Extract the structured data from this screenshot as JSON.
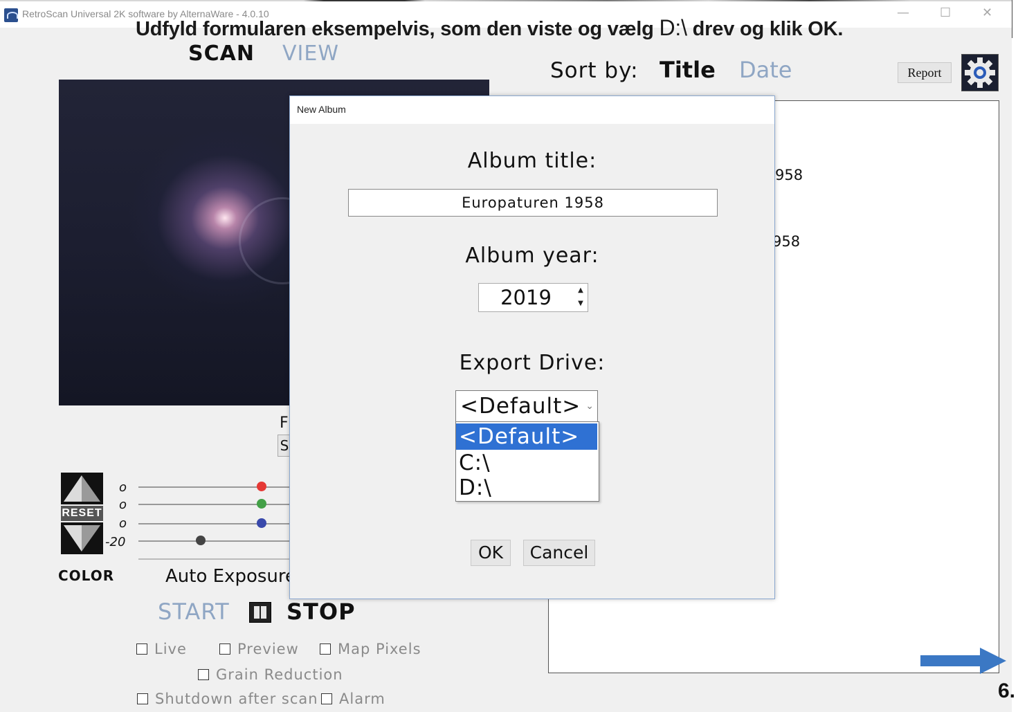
{
  "window": {
    "title": "RetroScan Universal 2K software by AlternaWare - 4.0.10",
    "minimize": "—",
    "maximize": "☐",
    "close": "✕"
  },
  "instruction": {
    "before": "Udfyld formularen eksempelvis, som den viste og vælg ",
    "drive": "D:\\",
    "after": " drev og klik OK."
  },
  "tabs": {
    "scan": "SCAN",
    "view": "VIEW"
  },
  "sort": {
    "label": "Sort by:",
    "title": "Title",
    "date": "Date"
  },
  "toolbar": {
    "report": "Report",
    "settings_icon": "gear-icon"
  },
  "album_list": {
    "entries": [
      "958",
      "958"
    ]
  },
  "color_controls": {
    "reset": "RESET",
    "label": "COLOR",
    "values": [
      "o",
      "o",
      "o",
      "-20"
    ],
    "knob_colors": [
      "#e53935",
      "#43a047",
      "#3949ab",
      "#444444"
    ]
  },
  "partial": {
    "f": "F",
    "s": "S"
  },
  "auto_exposure": "Auto Exposure",
  "transport": {
    "start": "START",
    "stop": "STOP"
  },
  "checkboxes": {
    "live": "Live",
    "preview": "Preview",
    "map_pixels": "Map Pixels",
    "grain_reduction": "Grain Reduction",
    "shutdown": "Shutdown after scan",
    "alarm": "Alarm"
  },
  "dialog": {
    "title": "New Album",
    "album_title_label": "Album title:",
    "album_title_value": "Europaturen 1958",
    "album_year_label": "Album year:",
    "album_year_value": "2019",
    "export_drive_label": "Export Drive:",
    "selected_drive": "<Default>",
    "drive_options": [
      "<Default>",
      "C:\\",
      "D:\\"
    ],
    "ok": "OK",
    "cancel": "Cancel"
  },
  "page_number": "6.",
  "colors": {
    "accent": "#2f71d3",
    "inactive": "#8fa6c4",
    "arrow": "#3b78c4"
  }
}
